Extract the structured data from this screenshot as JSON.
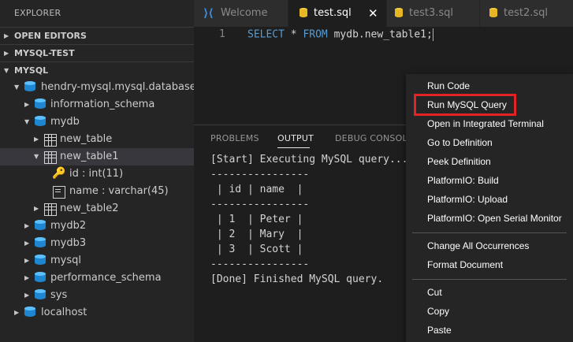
{
  "sidebar": {
    "title": "EXPLORER",
    "sections": [
      "OPEN EDITORS",
      "MYSQL-TEST",
      "MYSQL"
    ],
    "tree": {
      "server": "hendry-mysql.mysql.database.az...",
      "db_information_schema": "information_schema",
      "db_mydb": "mydb",
      "table_new_table": "new_table",
      "table_new_table1": "new_table1",
      "col_id": "id : int(11)",
      "col_name": "name : varchar(45)",
      "table_new_table2": "new_table2",
      "db_mydb2": "mydb2",
      "db_mydb3": "mydb3",
      "db_mysql": "mysql",
      "db_performance_schema": "performance_schema",
      "db_sys": "sys",
      "localhost": "localhost"
    }
  },
  "tabs": {
    "welcome": "Welcome",
    "test_sql": "test.sql",
    "test3_sql": "test3.sql",
    "test2_sql": "test2.sql",
    "close_glyph": "✕"
  },
  "editor": {
    "line_number": "1",
    "kw_select": "SELECT",
    "star": " * ",
    "kw_from": "FROM",
    "rest": " mydb.new_table1;"
  },
  "panel": {
    "tabs": [
      "PROBLEMS",
      "OUTPUT",
      "DEBUG CONSOLE"
    ],
    "output": [
      "[Start] Executing MySQL query...",
      "----------------",
      " | id | name  |",
      "----------------",
      " | 1  | Peter |",
      " | 2  | Mary  |",
      " | 3  | Scott |",
      "----------------",
      "[Done] Finished MySQL query."
    ]
  },
  "context_menu": {
    "group1": [
      "Run Code",
      "Run MySQL Query",
      "Open in Integrated Terminal",
      "Go to Definition",
      "Peek Definition",
      "PlatformIO: Build",
      "PlatformIO: Upload",
      "PlatformIO: Open Serial Monitor"
    ],
    "group2": [
      "Change All Occurrences",
      "Format Document"
    ],
    "group3": [
      "Cut",
      "Copy",
      "Paste"
    ],
    "highlighted": "Run MySQL Query",
    "highlight_color": "#e32226"
  },
  "colors": {
    "keyword": "#569cd6",
    "db_icon": "#1f86d1",
    "sql_icon": "#e7b622",
    "key_icon": "#e8c14d"
  },
  "icons": {
    "chevron_right": "chevron-right-icon",
    "chevron_down": "chevron-down-icon",
    "database": "database-icon",
    "table": "table-icon",
    "key": "key-icon",
    "column": "column-icon",
    "vscode": "vscode-icon",
    "sql_file": "sql-file-icon"
  }
}
